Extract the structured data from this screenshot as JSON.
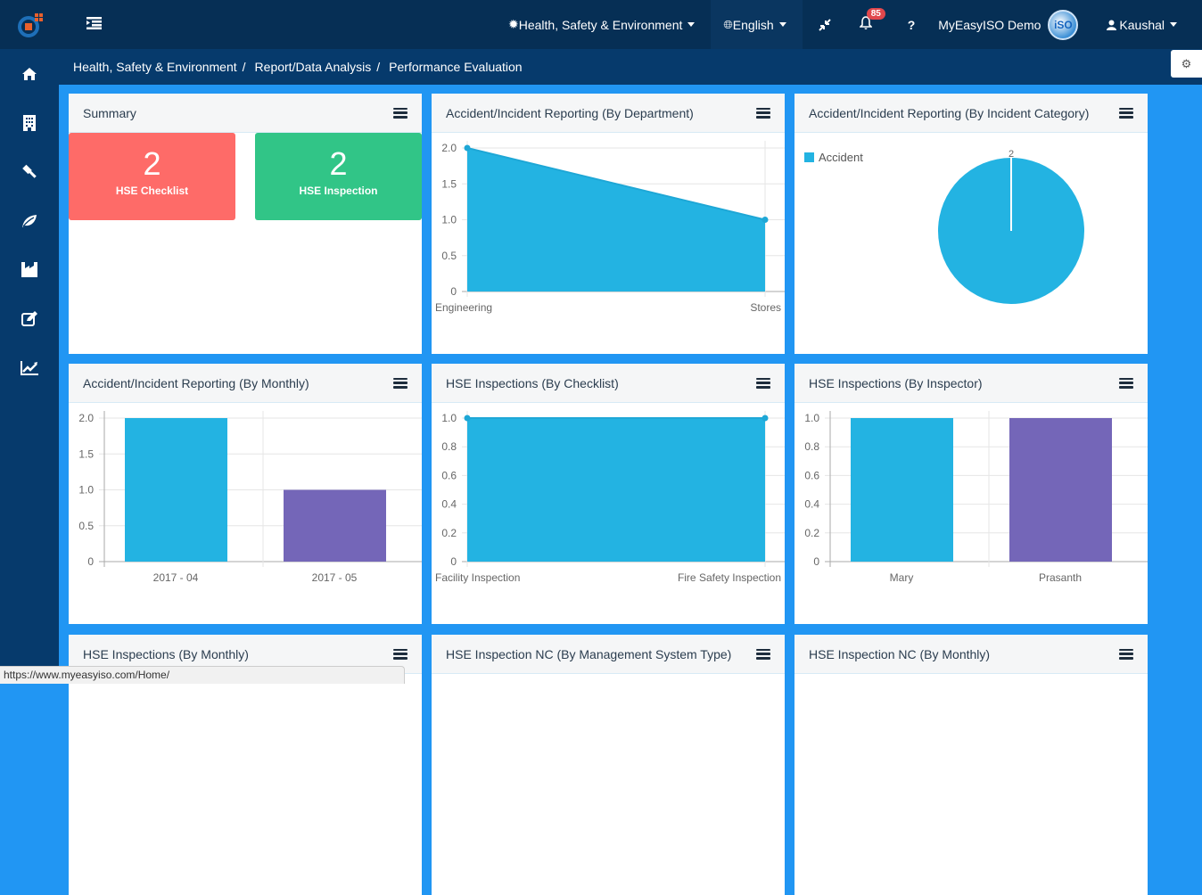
{
  "topbar": {
    "module_label": "Health, Safety & Environment",
    "language_label": "English",
    "notification_count": "85",
    "help_label": "?",
    "company_label": "MyEasyISO Demo",
    "avatar_text": "iSO",
    "user_label": "Kaushal"
  },
  "sidebar": {
    "items": [
      {
        "name": "home-icon",
        "glyph": "home"
      },
      {
        "name": "building-icon",
        "glyph": "building"
      },
      {
        "name": "gavel-icon",
        "glyph": "gavel"
      },
      {
        "name": "leaf-icon",
        "glyph": "leaf"
      },
      {
        "name": "industry-icon",
        "glyph": "industry"
      },
      {
        "name": "edit-icon",
        "glyph": "edit"
      },
      {
        "name": "line-chart-icon",
        "glyph": "chart"
      }
    ]
  },
  "breadcrumb": {
    "items": [
      "Health, Safety & Environment",
      "Report/Data Analysis",
      "Performance Evaluation"
    ],
    "separator": "/"
  },
  "colors": {
    "topbar": "#062f55",
    "sidebar": "#063a6c",
    "content_bg": "#2196f3",
    "series_blue": "#23b3e2",
    "series_purple": "#7466b8",
    "tile_red": "#fe6b68",
    "tile_green": "#31c587"
  },
  "panels": {
    "summary": {
      "title": "Summary",
      "tiles": [
        {
          "value": "2",
          "label": "HSE Checklist"
        },
        {
          "value": "2",
          "label": "HSE Inspection"
        }
      ]
    },
    "by_department": {
      "title": "Accident/Incident Reporting (By Department)"
    },
    "by_category": {
      "title": "Accident/Incident Reporting (By Incident Category)"
    },
    "by_monthly": {
      "title": "Accident/Incident Reporting (By Monthly)"
    },
    "by_checklist": {
      "title": "HSE Inspections (By Checklist)"
    },
    "by_inspector": {
      "title": "HSE Inspections (By Inspector)"
    },
    "hse_monthly": {
      "title": "HSE Inspections (By Monthly)"
    },
    "nc_mgmt": {
      "title": "HSE Inspection NC (By Management System Type)"
    },
    "nc_monthly": {
      "title": "HSE Inspection NC (By Monthly)"
    }
  },
  "statusbar": {
    "url": "https://www.myeasyiso.com/Home/"
  },
  "chart_data": [
    {
      "id": "by_department",
      "type": "area",
      "title": "Accident/Incident Reporting (By Department)",
      "categories": [
        "Engineering",
        "Stores"
      ],
      "values": [
        2,
        1
      ],
      "yticks": [
        "0",
        "0.5",
        "1.0",
        "1.5",
        "2.0"
      ],
      "ylim": [
        0,
        2
      ],
      "grid": true
    },
    {
      "id": "by_category",
      "type": "pie",
      "title": "Accident/Incident Reporting (By Incident Category)",
      "labels": [
        "Accident"
      ],
      "values": [
        2
      ],
      "data_labels": [
        "2"
      ],
      "legend": "top-left"
    },
    {
      "id": "by_monthly",
      "type": "bar",
      "title": "Accident/Incident Reporting (By Monthly)",
      "categories": [
        "2017 - 04",
        "2017 - 05"
      ],
      "values": [
        2,
        1
      ],
      "yticks": [
        "0",
        "0.5",
        "1.0",
        "1.5",
        "2.0"
      ],
      "ylim": [
        0,
        2
      ],
      "grid": true
    },
    {
      "id": "by_checklist",
      "type": "area",
      "title": "HSE Inspections (By Checklist)",
      "categories": [
        "Facility Inspection",
        "Fire Safety Inspection"
      ],
      "values": [
        1,
        1
      ],
      "yticks": [
        "0",
        "0.2",
        "0.4",
        "0.6",
        "0.8",
        "1.0"
      ],
      "ylim": [
        0,
        1
      ],
      "grid": true
    },
    {
      "id": "by_inspector",
      "type": "bar",
      "title": "HSE Inspections (By Inspector)",
      "categories": [
        "Mary",
        "Prasanth"
      ],
      "values": [
        1,
        1
      ],
      "yticks": [
        "0",
        "0.2",
        "0.4",
        "0.6",
        "0.8",
        "1.0"
      ],
      "ylim": [
        0,
        1
      ],
      "grid": true
    }
  ]
}
